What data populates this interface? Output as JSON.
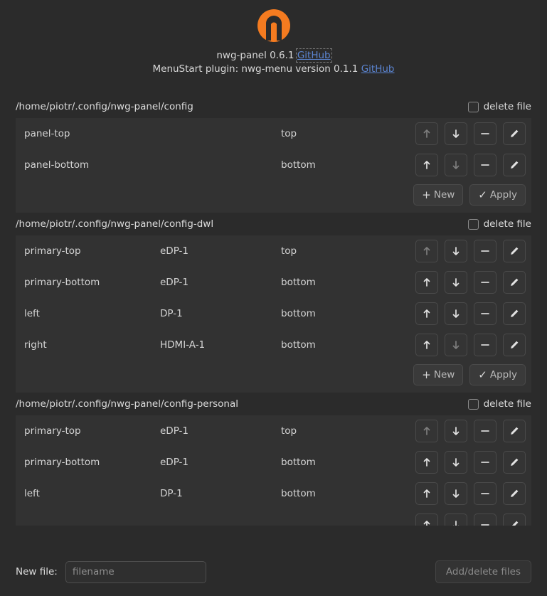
{
  "app": {
    "logo_icon": "nwg-logo-icon",
    "logo_color": "#f47b20",
    "about_prefix": "nwg-panel 0.6.1",
    "about_link": "GitHub",
    "plugin_prefix": "MenuStart plugin: nwg-menu version 0.1.1",
    "plugin_link": "GitHub",
    "link_color": "#5b84d0"
  },
  "row_buttons": {
    "move_up": "↑",
    "move_down": "↓",
    "remove": "−",
    "edit": "pencil-icon"
  },
  "actions": {
    "new_label": "New",
    "new_glyph": "+",
    "apply_label": "Apply",
    "apply_glyph": "✓"
  },
  "delete_file_label": "delete file",
  "sections": [
    {
      "path": "/home/piotr/.config/nwg-panel/config",
      "delete_file_checked": false,
      "columns": [
        "name",
        "position"
      ],
      "rows": [
        {
          "name": "panel-top",
          "output": "",
          "position": "top",
          "up_enabled": false,
          "down_enabled": true
        },
        {
          "name": "panel-bottom",
          "output": "",
          "position": "bottom",
          "up_enabled": true,
          "down_enabled": false
        }
      ],
      "has_actions": true,
      "clipped": false
    },
    {
      "path": "/home/piotr/.config/nwg-panel/config-dwl",
      "delete_file_checked": false,
      "columns": [
        "name",
        "output",
        "position"
      ],
      "rows": [
        {
          "name": "primary-top",
          "output": "eDP-1",
          "position": "top",
          "up_enabled": false,
          "down_enabled": true
        },
        {
          "name": "primary-bottom",
          "output": "eDP-1",
          "position": "bottom",
          "up_enabled": true,
          "down_enabled": true
        },
        {
          "name": "left",
          "output": "DP-1",
          "position": "bottom",
          "up_enabled": true,
          "down_enabled": true
        },
        {
          "name": "right",
          "output": "HDMI-A-1",
          "position": "bottom",
          "up_enabled": true,
          "down_enabled": false
        }
      ],
      "has_actions": true,
      "clipped": false
    },
    {
      "path": "/home/piotr/.config/nwg-panel/config-personal",
      "delete_file_checked": false,
      "columns": [
        "name",
        "output",
        "position"
      ],
      "rows": [
        {
          "name": "primary-top",
          "output": "eDP-1",
          "position": "top",
          "up_enabled": false,
          "down_enabled": true
        },
        {
          "name": "primary-bottom",
          "output": "eDP-1",
          "position": "bottom",
          "up_enabled": true,
          "down_enabled": true
        },
        {
          "name": "left",
          "output": "DP-1",
          "position": "bottom",
          "up_enabled": true,
          "down_enabled": true
        },
        {
          "name": "",
          "output": "",
          "position": "",
          "up_enabled": true,
          "down_enabled": true
        }
      ],
      "has_actions": false,
      "clipped": true
    }
  ],
  "bottom": {
    "new_file_label": "New file:",
    "new_file_value": "",
    "new_file_placeholder": "filename",
    "add_delete_label": "Add/delete files",
    "add_delete_enabled": false
  }
}
